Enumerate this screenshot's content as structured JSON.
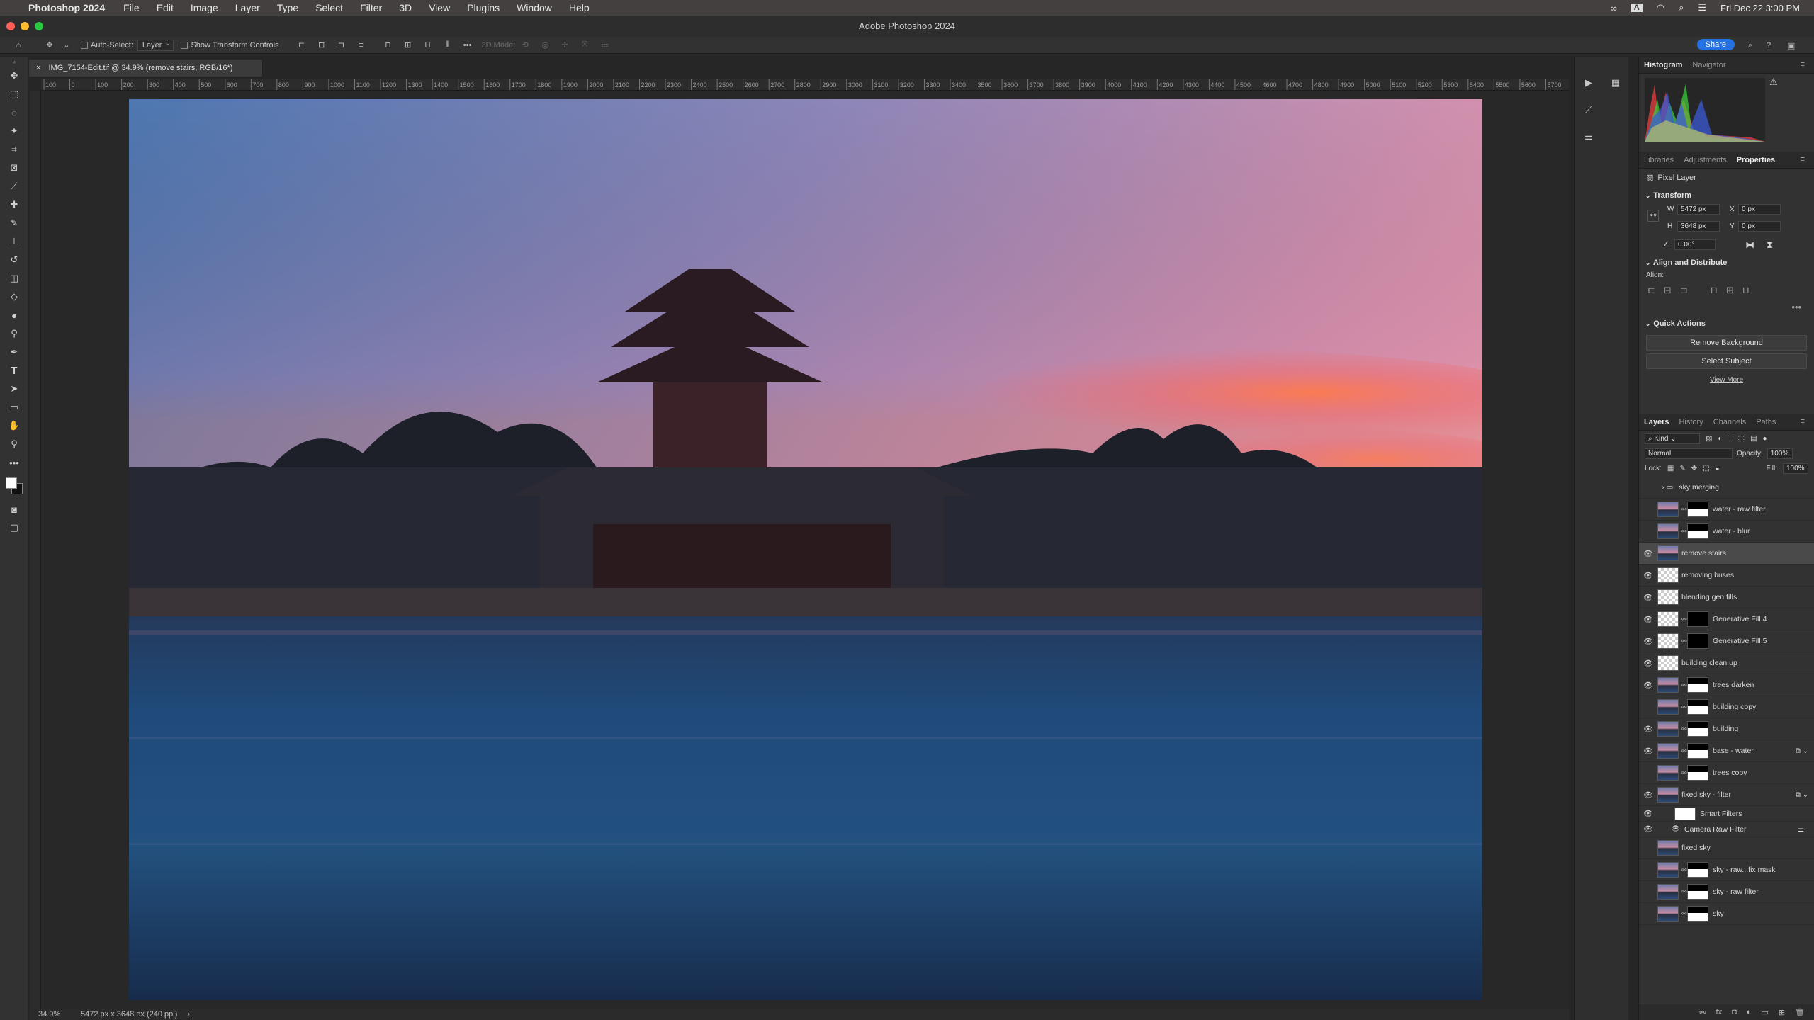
{
  "menubar": {
    "app": "Photoshop 2024",
    "items": [
      "File",
      "Edit",
      "Image",
      "Layer",
      "Type",
      "Select",
      "Filter",
      "3D",
      "View",
      "Plugins",
      "Window",
      "Help"
    ],
    "datetime": "Fri Dec 22  3:00 PM"
  },
  "window": {
    "title": "Adobe Photoshop 2024"
  },
  "options": {
    "auto_select_label": "Auto-Select:",
    "auto_select_value": "Layer",
    "transform_label": "Show Transform Controls",
    "mode3d": "3D Mode:",
    "share": "Share"
  },
  "document": {
    "tab": "IMG_7154-Edit.tif @ 34.9% (remove stairs, RGB/16*)",
    "zoom": "34.9%",
    "dims": "5472 px x 3648 px (240 ppi)"
  },
  "ruler": {
    "h_labels": [
      "100",
      "0",
      "100",
      "200",
      "300",
      "400",
      "500",
      "600",
      "700",
      "800",
      "900",
      "1000",
      "1100",
      "1200",
      "1300",
      "1400",
      "1500",
      "1600",
      "1700",
      "1800",
      "1900",
      "2000",
      "2100",
      "2200",
      "2300",
      "2400",
      "2500",
      "2600",
      "2700",
      "2800",
      "2900",
      "3000",
      "3100",
      "3200",
      "3300",
      "3400",
      "3500",
      "3600",
      "3700",
      "3800",
      "3900",
      "4000",
      "4100",
      "4200",
      "4300",
      "4400",
      "4500",
      "4600",
      "4700",
      "4800",
      "4900",
      "5000",
      "5100",
      "5200",
      "5300",
      "5400",
      "5500",
      "5600",
      "5700"
    ]
  },
  "top_panel": {
    "tabs": [
      "Histogram",
      "Navigator"
    ]
  },
  "props_panel": {
    "tabs": [
      "Libraries",
      "Adjustments",
      "Properties"
    ],
    "kind": "Pixel Layer",
    "transform_title": "Transform",
    "w": "5472 px",
    "h": "3648 px",
    "x": "0 px",
    "y": "0 px",
    "angle": "0.00°",
    "w_lbl": "W",
    "h_lbl": "H",
    "x_lbl": "X",
    "y_lbl": "Y",
    "align_title": "Align and Distribute",
    "align_label": "Align:",
    "qa_title": "Quick Actions",
    "remove_bg": "Remove Background",
    "select_subject": "Select Subject",
    "view_more": "View More"
  },
  "layers_panel": {
    "tabs": [
      "Layers",
      "History",
      "Channels",
      "Paths"
    ],
    "kind": "Kind",
    "blend": "Normal",
    "opacity_label": "Opacity:",
    "opacity": "100%",
    "lock_label": "Lock:",
    "fill_label": "Fill:",
    "fill": "100%"
  },
  "layers": [
    {
      "name": "sky merging",
      "visible": false,
      "type": "group"
    },
    {
      "name": "water - raw filter",
      "visible": false,
      "type": "mask"
    },
    {
      "name": "water - blur",
      "visible": false,
      "type": "mask"
    },
    {
      "name": "remove stairs",
      "visible": true,
      "type": "photo",
      "selected": true
    },
    {
      "name": "removing buses",
      "visible": true,
      "type": "trans"
    },
    {
      "name": "blending gen fills",
      "visible": true,
      "type": "trans"
    },
    {
      "name": "Generative Fill 4",
      "visible": true,
      "type": "genfill"
    },
    {
      "name": "Generative Fill 5",
      "visible": true,
      "type": "genfill"
    },
    {
      "name": "building clean up",
      "visible": true,
      "type": "trans"
    },
    {
      "name": "trees darken",
      "visible": true,
      "type": "mask"
    },
    {
      "name": "building copy",
      "visible": false,
      "type": "mask"
    },
    {
      "name": "building",
      "visible": true,
      "type": "mask"
    },
    {
      "name": "base - water",
      "visible": true,
      "type": "mask"
    },
    {
      "name": "trees copy",
      "visible": false,
      "type": "mask"
    },
    {
      "name": "fixed sky - filter",
      "visible": true,
      "type": "smart"
    },
    {
      "name": "Smart Filters",
      "visible": true,
      "type": "sf"
    },
    {
      "name": "Camera Raw Filter",
      "visible": true,
      "type": "crf"
    },
    {
      "name": "fixed sky",
      "visible": false,
      "type": "photo"
    },
    {
      "name": "sky - raw...fix mask",
      "visible": false,
      "type": "mask"
    },
    {
      "name": "sky - raw filter",
      "visible": false,
      "type": "mask"
    },
    {
      "name": "sky",
      "visible": false,
      "type": "mask"
    }
  ]
}
